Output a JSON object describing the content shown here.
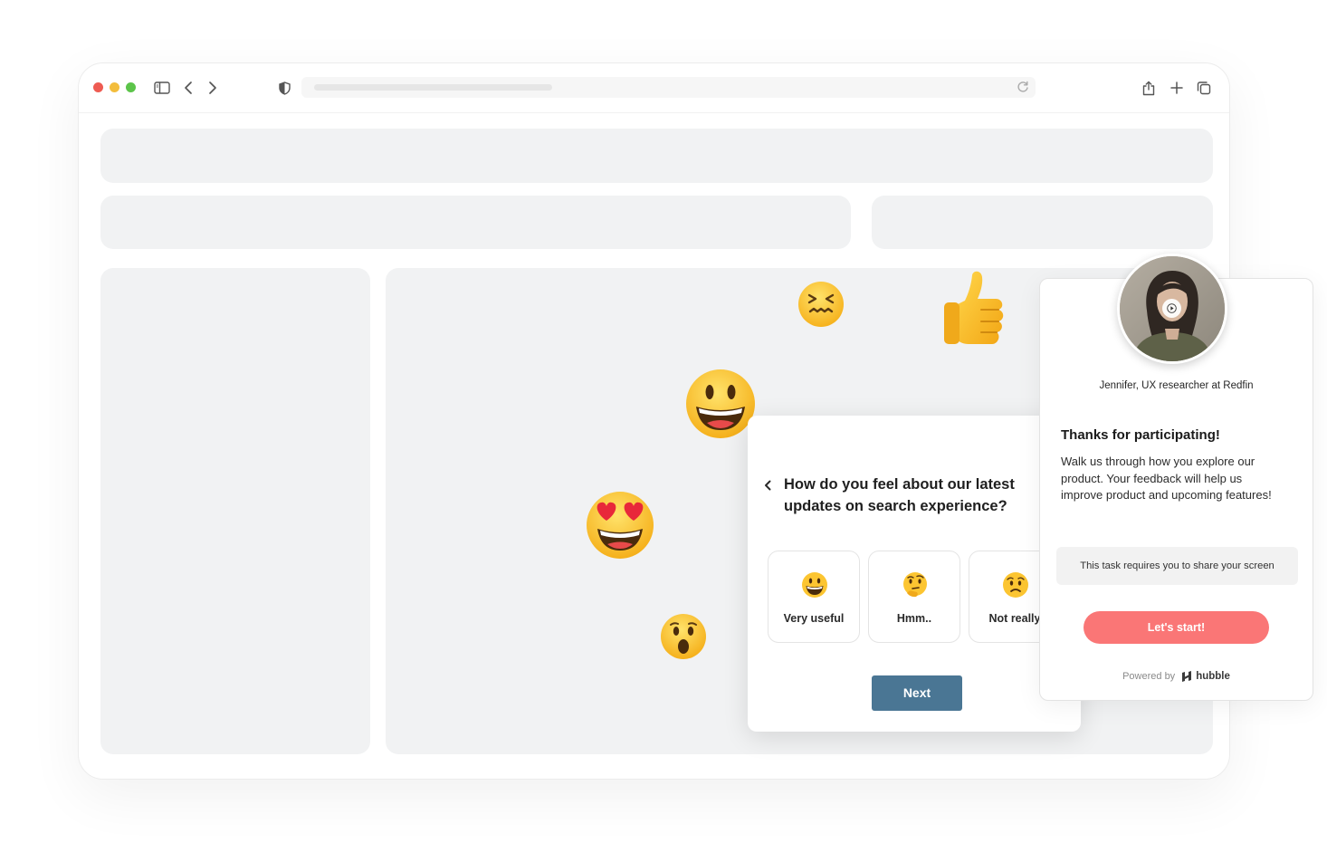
{
  "survey": {
    "question": "How do you feel about our latest updates on search experience?",
    "options": [
      {
        "label": "Very useful",
        "icon": "grinning-face-icon"
      },
      {
        "label": "Hmm..",
        "icon": "thinking-face-icon"
      },
      {
        "label": "Not really",
        "icon": "worried-face-icon"
      }
    ],
    "next_label": "Next"
  },
  "invite": {
    "researcher": "Jennifer, UX researcher at Redfin",
    "title": "Thanks for participating!",
    "body": "Walk us through how you explore our product. Your feedback will help us improve product and upcoming features!",
    "note": "This task requires you to share your screen",
    "start_label": "Let's start!",
    "powered_by": "Powered by",
    "brand": "hubble"
  },
  "colors": {
    "next_button": "#4a7694",
    "start_button": "#fa7676",
    "placeholder": "#f1f2f3"
  }
}
